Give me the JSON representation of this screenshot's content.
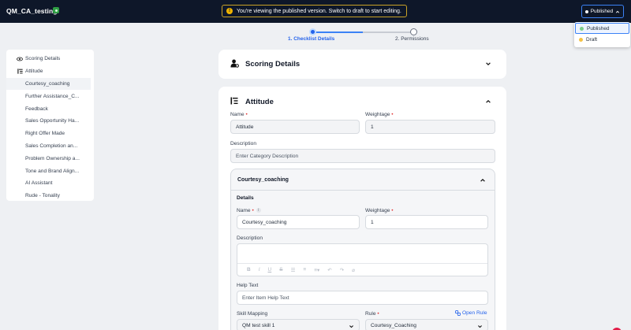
{
  "app": {
    "title": "QM_CA_testing"
  },
  "banner": {
    "text": "You're viewing the published version. Switch to draft to start editing."
  },
  "version_button": {
    "label": "Published"
  },
  "version_menu": {
    "items": [
      {
        "label": "Published",
        "color": "#7ccf8a"
      },
      {
        "label": "Draft",
        "color": "#f5c242"
      }
    ]
  },
  "stepper": {
    "steps": [
      {
        "label": "1. Checklist Details"
      },
      {
        "label": "2. Permissions"
      }
    ]
  },
  "sidebar": {
    "items": [
      {
        "label": "Scoring Details"
      },
      {
        "label": "Attitude"
      },
      {
        "label": "Courtesy_coaching"
      },
      {
        "label": "Further Assistance_C..."
      },
      {
        "label": "Feedback"
      },
      {
        "label": "Sales Opportunity Ha..."
      },
      {
        "label": "Right Offer Made"
      },
      {
        "label": "Sales Completion an..."
      },
      {
        "label": "Problem Ownership a..."
      },
      {
        "label": "Tone and Brand Align..."
      },
      {
        "label": "AI Assistant"
      },
      {
        "label": "Rude - Tonality"
      }
    ]
  },
  "scoring_card": {
    "title": "Scoring Details"
  },
  "attitude_card": {
    "title": "Attitude",
    "name_label": "Name",
    "name_value": "Attitude",
    "weightage_label": "Weightage",
    "weightage_value": "1",
    "description_label": "Description",
    "description_placeholder": "Enter Category Description"
  },
  "item_card": {
    "title": "Courtesy_coaching",
    "details_label": "Details",
    "name_label": "Name",
    "name_value": "Courtesy_coaching",
    "weightage_label": "Weightage",
    "weightage_value": "1",
    "description_label": "Description",
    "help_text_label": "Help Text",
    "help_text_placeholder": "Enter Item Help Text",
    "skill_mapping_label": "Skill Mapping",
    "skill_mapping_value": "QM test skill 1",
    "rule_label": "Rule",
    "rule_value": "Courtesy_Coaching",
    "open_rule_label": "Open Rule"
  },
  "colors": {
    "accent": "#2563eb",
    "topbar": "#0e1729",
    "required": "#e03131"
  }
}
